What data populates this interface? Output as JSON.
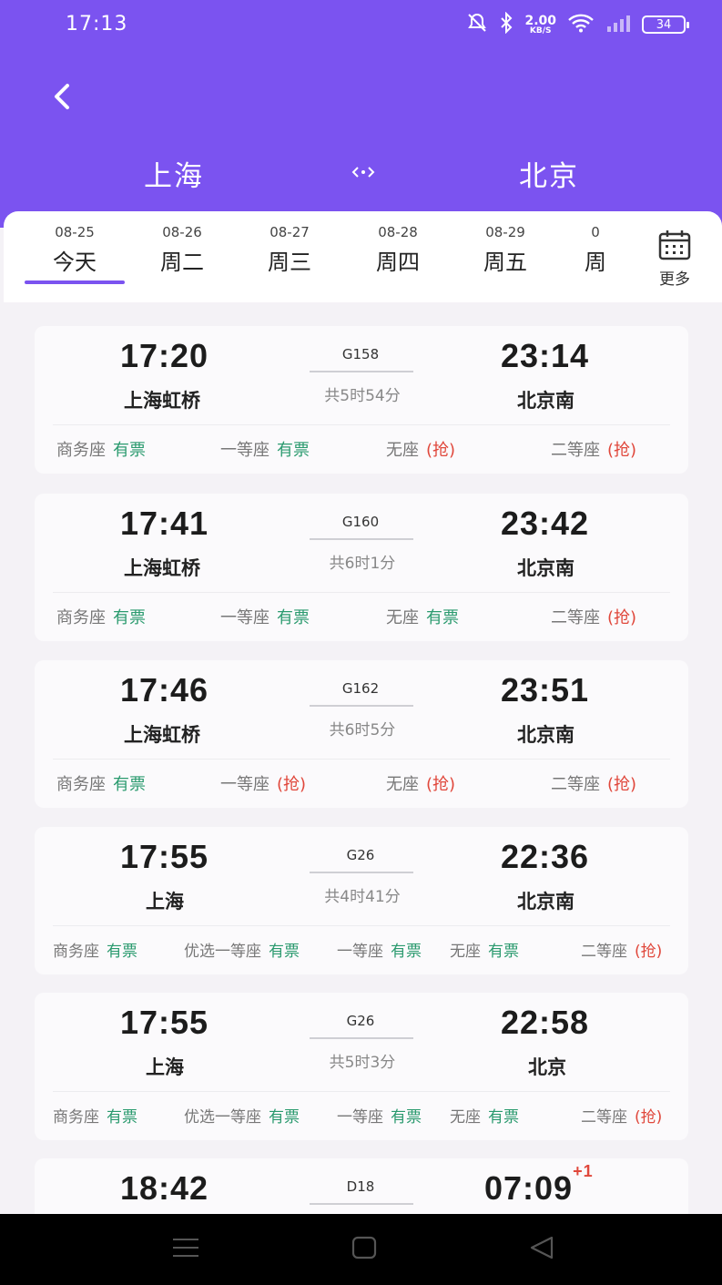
{
  "status_bar": {
    "time": "17:13",
    "net_speed": "2.00",
    "net_unit": "KB/S",
    "battery": "34"
  },
  "route": {
    "from": "上海",
    "to": "北京"
  },
  "dates": [
    {
      "date": "08-25",
      "label": "今天",
      "selected": true
    },
    {
      "date": "08-26",
      "label": "周二"
    },
    {
      "date": "08-27",
      "label": "周三"
    },
    {
      "date": "08-28",
      "label": "周四"
    },
    {
      "date": "08-29",
      "label": "周五"
    },
    {
      "date": "0",
      "label": "周"
    }
  ],
  "more_label": "更多",
  "trains": [
    {
      "dep_time": "17:20",
      "dep_station": "上海虹桥",
      "train_no": "G158",
      "duration": "共5时54分",
      "arr_time": "23:14",
      "arr_station": "北京南",
      "seats": [
        {
          "name": "商务座",
          "status": "有票"
        },
        {
          "name": "一等座",
          "status": "有票"
        },
        {
          "name": "无座",
          "status": "(抢)"
        },
        {
          "name": "二等座",
          "status": "(抢)"
        }
      ]
    },
    {
      "dep_time": "17:41",
      "dep_station": "上海虹桥",
      "train_no": "G160",
      "duration": "共6时1分",
      "arr_time": "23:42",
      "arr_station": "北京南",
      "seats": [
        {
          "name": "商务座",
          "status": "有票"
        },
        {
          "name": "一等座",
          "status": "有票"
        },
        {
          "name": "无座",
          "status": "有票"
        },
        {
          "name": "二等座",
          "status": "(抢)"
        }
      ]
    },
    {
      "dep_time": "17:46",
      "dep_station": "上海虹桥",
      "train_no": "G162",
      "duration": "共6时5分",
      "arr_time": "23:51",
      "arr_station": "北京南",
      "seats": [
        {
          "name": "商务座",
          "status": "有票"
        },
        {
          "name": "一等座",
          "status": "(抢)"
        },
        {
          "name": "无座",
          "status": "(抢)"
        },
        {
          "name": "二等座",
          "status": "(抢)"
        }
      ]
    },
    {
      "dep_time": "17:55",
      "dep_station": "上海",
      "train_no": "G26",
      "duration": "共4时41分",
      "arr_time": "22:36",
      "arr_station": "北京南",
      "seats": [
        {
          "name": "商务座",
          "status": "有票"
        },
        {
          "name": "优选一等座",
          "status": "有票"
        },
        {
          "name": "一等座",
          "status": "有票"
        },
        {
          "name": "无座",
          "status": "有票"
        },
        {
          "name": "二等座",
          "status": "(抢)"
        }
      ]
    },
    {
      "dep_time": "17:55",
      "dep_station": "上海",
      "train_no": "G26",
      "duration": "共5时3分",
      "arr_time": "22:58",
      "arr_station": "北京",
      "seats": [
        {
          "name": "商务座",
          "status": "有票"
        },
        {
          "name": "优选一等座",
          "status": "有票"
        },
        {
          "name": "一等座",
          "status": "有票"
        },
        {
          "name": "无座",
          "status": "有票"
        },
        {
          "name": "二等座",
          "status": "(抢)"
        }
      ]
    },
    {
      "dep_time": "18:42",
      "dep_station": "",
      "train_no": "D18",
      "duration": "",
      "arr_time": "07:09",
      "next_day": "+1",
      "arr_station": "",
      "seats": []
    }
  ]
}
